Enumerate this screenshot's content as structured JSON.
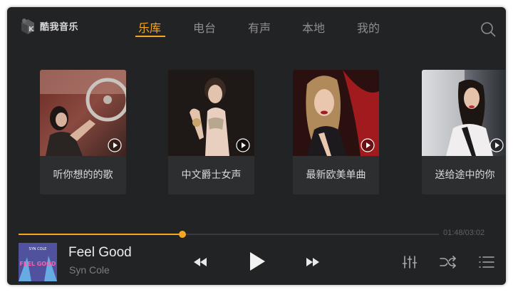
{
  "app": {
    "name": "酷我音乐"
  },
  "tabs": [
    {
      "label": "乐库",
      "active": true
    },
    {
      "label": "电台",
      "active": false
    },
    {
      "label": "有声",
      "active": false
    },
    {
      "label": "本地",
      "active": false
    },
    {
      "label": "我的",
      "active": false
    }
  ],
  "playlists": [
    {
      "label": "听你想的的歌",
      "icon": "play-icon"
    },
    {
      "label": "中文爵士女声",
      "icon": "play-icon"
    },
    {
      "label": "最新欧美单曲",
      "icon": "play-icon"
    },
    {
      "label": "送给途中的你",
      "icon": "play-icon"
    }
  ],
  "player": {
    "title": "Feel Good",
    "artist": "Syn Cole",
    "time": "01:48/03:02",
    "progress": 0.39,
    "cover_text_top": "SYN COLE",
    "cover_text_main": "FEEL GOOD"
  },
  "colors": {
    "accent": "#f5a623",
    "background": "#222325",
    "tab_inactive": "#8e8e8e"
  },
  "icons": [
    "kuwo-logo-icon",
    "search-icon",
    "play-icon",
    "previous-icon",
    "play-pause-icon",
    "next-icon",
    "equalizer-icon",
    "shuffle-icon",
    "playlist-icon"
  ]
}
